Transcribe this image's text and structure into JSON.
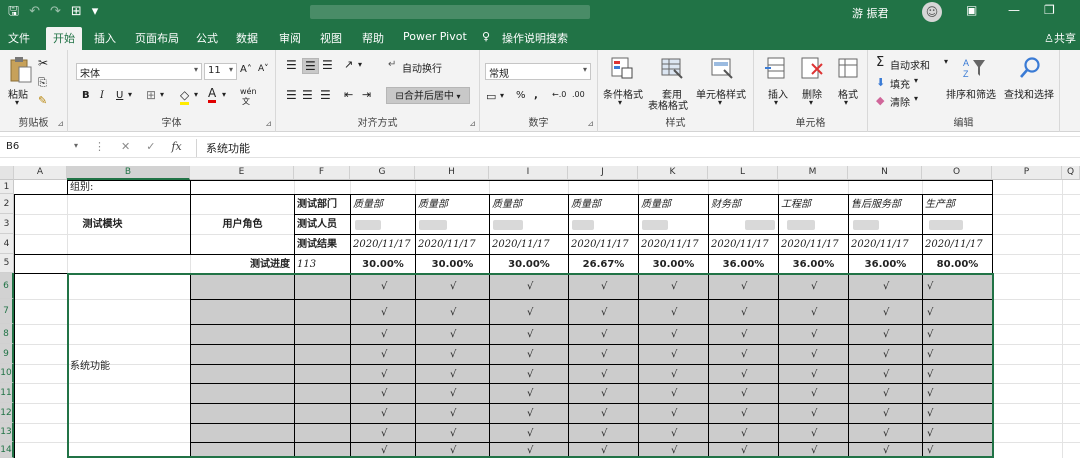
{
  "title_bar": {
    "user_name": "游 振君",
    "avatar_glyph": "☺",
    "qat": [
      "🖫",
      "↶",
      "↷",
      "⊞",
      "▾"
    ],
    "window_controls": [
      "▣",
      "—",
      "❐"
    ]
  },
  "tabs": [
    {
      "label": "文件",
      "active": false
    },
    {
      "label": "开始",
      "active": true
    },
    {
      "label": "插入",
      "active": false
    },
    {
      "label": "页面布局",
      "active": false
    },
    {
      "label": "公式",
      "active": false
    },
    {
      "label": "数据",
      "active": false
    },
    {
      "label": "审阅",
      "active": false
    },
    {
      "label": "视图",
      "active": false
    },
    {
      "label": "帮助",
      "active": false
    },
    {
      "label": "Power Pivot",
      "active": false
    },
    {
      "label": "操作说明搜索",
      "active": false
    }
  ],
  "share_label": "共享",
  "ribbon": {
    "clipboard": {
      "paste": "粘贴",
      "group": "剪贴板"
    },
    "font": {
      "name": "宋体",
      "size": "11",
      "grow": "A˄",
      "shrink": "A˅",
      "bold": "B",
      "italic": "I",
      "underline": "U",
      "wen": "wén",
      "group": "字体"
    },
    "alignment": {
      "wrap": "自动换行",
      "merge": "合并后居中",
      "group": "对齐方式"
    },
    "number": {
      "format": "常规",
      "percent": "%",
      "comma": ",",
      "inc_dec": "←.0",
      "dec_dec": ".00",
      "group": "数字"
    },
    "styles": {
      "conditional": "条件格式",
      "table_1": "套用",
      "table_2": "表格格式",
      "cell_styles": "单元格样式",
      "group": "样式"
    },
    "cells": {
      "insert": "插入",
      "delete": "删除",
      "format": "格式",
      "group": "单元格"
    },
    "editing": {
      "autosum": "自动求和",
      "fill": "填充",
      "clear": "清除",
      "sort": "排序和筛选",
      "find": "查找和选择",
      "group": "编辑"
    }
  },
  "formula_bar": {
    "name_box": "B6",
    "value": "系统功能",
    "cancel": "✕",
    "enter": "✓",
    "fx": "fx"
  },
  "columns": [
    "A",
    "B",
    "E",
    "F",
    "G",
    "H",
    "I",
    "J",
    "K",
    "L",
    "M",
    "N",
    "O",
    "P",
    "Q"
  ],
  "rows": [
    "1",
    "2",
    "3",
    "4",
    "5",
    "6",
    "7",
    "8",
    "9",
    "10",
    "11",
    "12",
    "13",
    "14"
  ],
  "sheet": {
    "group_label": "组别:",
    "test_module": "测试模块",
    "user_role": "用户角色",
    "label_dept": "测试部门",
    "label_person": "测试人员",
    "label_result": "测试结果",
    "label_progress": "测试进度",
    "progress_total": "113",
    "module_b6": "系统功能",
    "departments": [
      "质量部",
      "质量部",
      "质量部",
      "质量部",
      "质量部",
      "财务部",
      "工程部",
      "售后服务部",
      "生产部"
    ],
    "dates": [
      "2020/11/17",
      "2020/11/17",
      "2020/11/17",
      "2020/11/17",
      "2020/11/17",
      "2020/11/17",
      "2020/11/17",
      "2020/11/17",
      "2020/11/17"
    ],
    "percents": [
      "30.00%",
      "30.00%",
      "30.00%",
      "26.67%",
      "30.00%",
      "36.00%",
      "36.00%",
      "36.00%",
      "80.00%"
    ],
    "check": "√"
  }
}
